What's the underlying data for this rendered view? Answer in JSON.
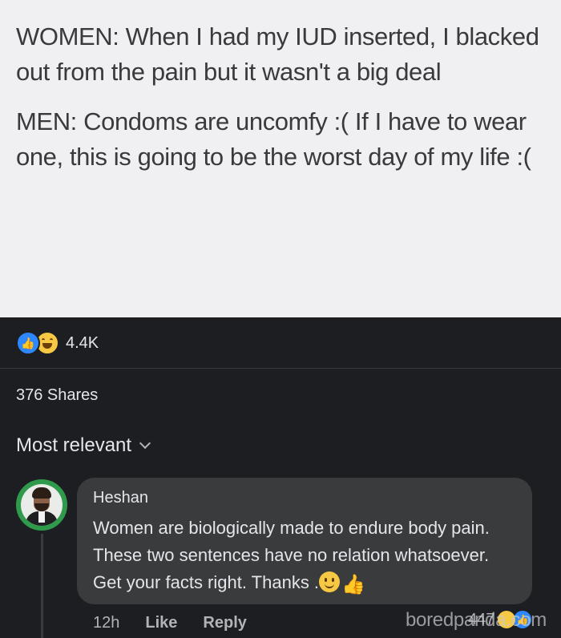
{
  "post": {
    "paragraph1": "WOMEN: When I had my IUD inserted, I blacked out from the pain but it wasn't a big deal",
    "paragraph2": "MEN: Condoms are uncomfy :( If I have to wear one, this is going to be the worst day of my life :("
  },
  "reactions": {
    "count": "4.4K",
    "icons": [
      "like-icon",
      "haha-icon"
    ]
  },
  "shares": "376 Shares",
  "sort": {
    "label": "Most relevant",
    "icon": "chevron-down-icon"
  },
  "comment": {
    "author": "Heshan",
    "text": "Women are biologically made to endure body pain. These two sentences have no relation whatsoever. Get your facts right. Thanks .",
    "time": "12h",
    "like_label": "Like",
    "reply_label": "Reply",
    "reaction_count": "447",
    "emoji": [
      "slightly-smiling-face-icon",
      "thumbs-up-icon"
    ]
  },
  "watermark": "boredpanda.com",
  "colors": {
    "post_background": "#f0f0f2",
    "dark_background": "#1c1e21",
    "bubble": "#3a3b3c",
    "like_blue": "#2d88ff",
    "avatar_ring": "#2f9a4b"
  }
}
